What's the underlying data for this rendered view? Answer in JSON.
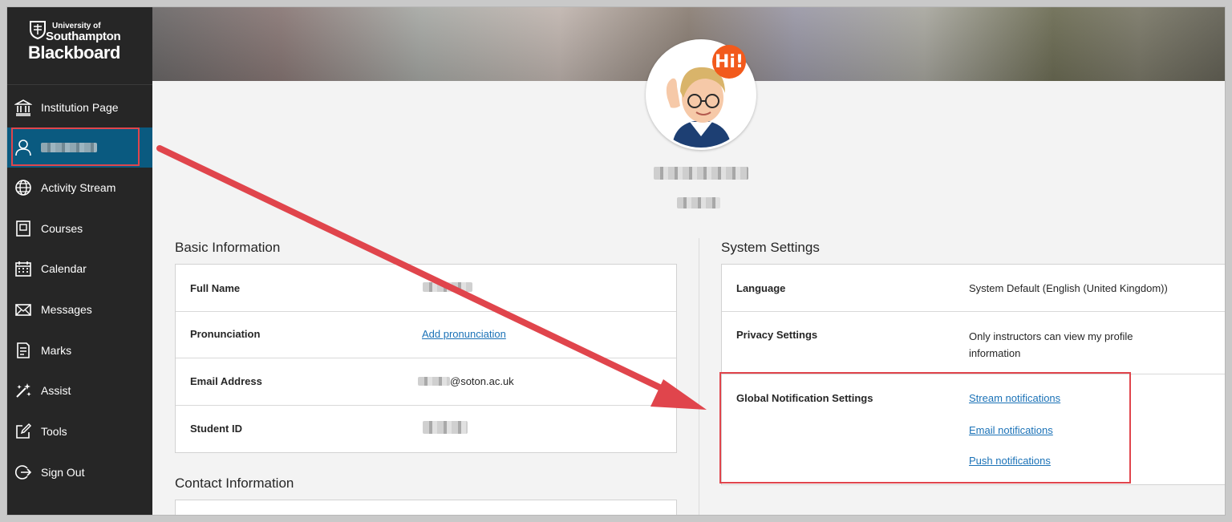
{
  "brand": {
    "university_line1": "University of",
    "university_line2": "Southampton",
    "product": "Blackboard"
  },
  "sidebar": {
    "items": [
      {
        "label": "Institution Page",
        "icon": "institution-icon"
      },
      {
        "label": "",
        "icon": "user-icon",
        "active": true
      },
      {
        "label": "Activity Stream",
        "icon": "globe-icon"
      },
      {
        "label": "Courses",
        "icon": "book-icon"
      },
      {
        "label": "Calendar",
        "icon": "calendar-icon"
      },
      {
        "label": "Messages",
        "icon": "envelope-icon"
      },
      {
        "label": "Marks",
        "icon": "document-icon"
      },
      {
        "label": "Assist",
        "icon": "wand-icon"
      },
      {
        "label": "Tools",
        "icon": "edit-icon"
      },
      {
        "label": "Sign Out",
        "icon": "sign-out-icon"
      }
    ]
  },
  "profile": {
    "avatar_badge": "Hi!"
  },
  "basic_information": {
    "title": "Basic Information",
    "rows": [
      {
        "label": "Full Name",
        "value": ""
      },
      {
        "label": "Pronunciation",
        "value": "Add pronunciation"
      },
      {
        "label": "Email Address",
        "value": "@soton.ac.uk"
      },
      {
        "label": "Student ID",
        "value": ""
      }
    ]
  },
  "contact_information": {
    "title": "Contact Information"
  },
  "system_settings": {
    "title": "System Settings",
    "rows": [
      {
        "label": "Language",
        "value": "System Default (English (United Kingdom))"
      },
      {
        "label": "Privacy Settings",
        "value": "Only instructors can view my profile information"
      },
      {
        "label": "Global Notification Settings",
        "links": [
          "Stream notifications",
          "Email notifications",
          "Push notifications"
        ]
      }
    ]
  },
  "colors": {
    "sidebar_bg": "#262626",
    "active_item": "#0a5a80",
    "link": "#1b72b7",
    "highlight": "#e0454c"
  }
}
